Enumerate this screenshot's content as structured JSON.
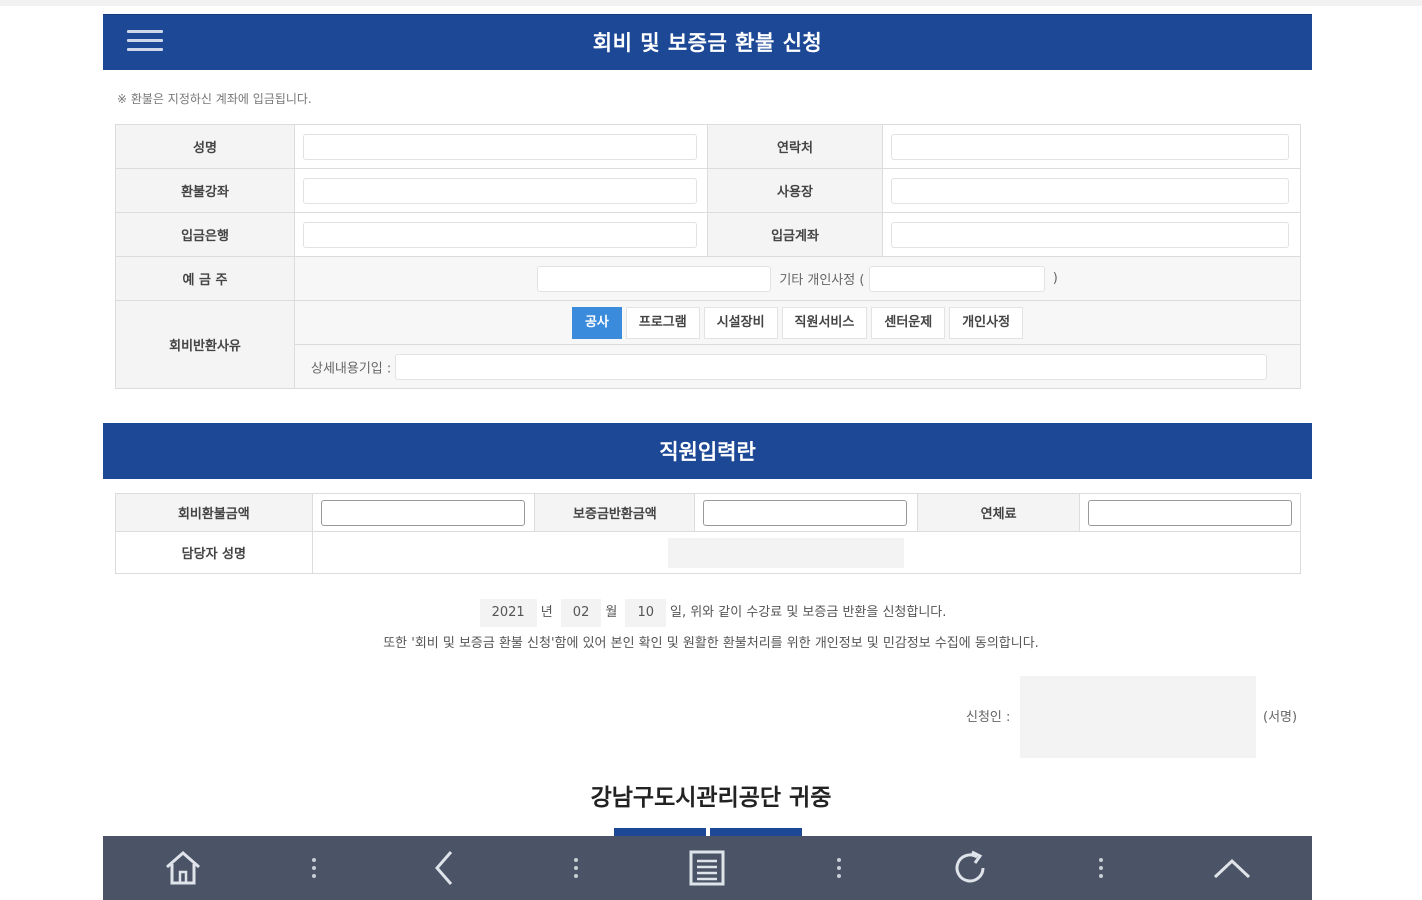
{
  "header": {
    "title": "회비 및 보증금 환불 신청"
  },
  "notice": "※ 환불은 지정하신 계좌에 입금됩니다.",
  "applicant_form": {
    "name_label": "성명",
    "contact_label": "연락처",
    "refund_course_label": "환불강좌",
    "location_label": "사용장",
    "bank_label": "입금은행",
    "account_label": "입금계좌",
    "depositor_label": "예 금 주",
    "other_reason_prefix": "기타 개인사정 (",
    "other_reason_suffix": ")",
    "reason_label": "회비반환사유",
    "reason_options": [
      "공사",
      "프로그램",
      "시설장비",
      "직원서비스",
      "센터운제",
      "개인사정"
    ],
    "selected_reason": "공사",
    "detail_label": "상세내용기입 :"
  },
  "staff_section": {
    "title": "직원입력란",
    "fee_refund_label": "회비환불금액",
    "deposit_refund_label": "보증금반환금액",
    "penalty_label": "연체료",
    "manager_label": "담당자 성명"
  },
  "statement": {
    "year": "2021",
    "year_unit": "년",
    "month": "02",
    "month_unit": "월",
    "day": "10",
    "line1_suffix": "일, 위와 같이 수강료 및 보증금 반환을 신청합니다.",
    "line2": "또한 '회비 및 보증금 환불 신청'함에 있어 본인 확인 및 원활한 환불처리를 위한 개인정보 및 민감정보 수집에 동의합니다."
  },
  "signature": {
    "label": "신청인 :",
    "suffix": "(서명)"
  },
  "recipient": "강남구도시관리공단 귀중",
  "colors": {
    "primary": "#1c4896",
    "active_chip": "#3a8bdc",
    "bottom_bar": "#4a5466"
  },
  "bottom_nav": [
    "home-icon",
    "back-icon",
    "page-icon",
    "refresh-icon",
    "scroll-top-icon"
  ]
}
